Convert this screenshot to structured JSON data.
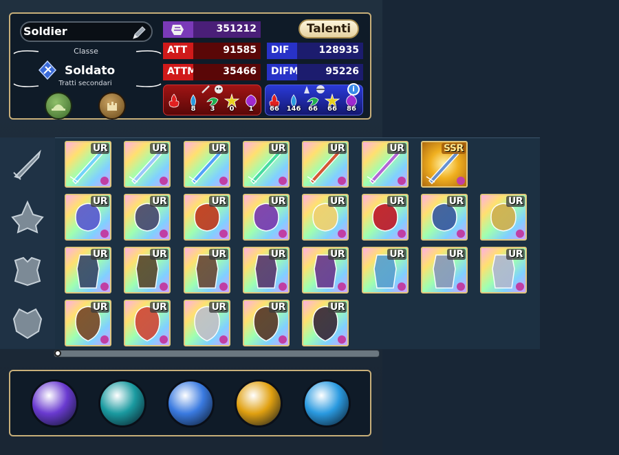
{
  "character": {
    "name": "Soldier",
    "class_heading": "Classe",
    "class_name": "Soldato",
    "traits_label": "Tratti secondari",
    "talent_button": "Talenti"
  },
  "stats": {
    "power": "351212",
    "att_label": "ATT",
    "att": "91585",
    "def_label": "DIF",
    "def": "128935",
    "attm_label": "ATTM",
    "attm": "35466",
    "defm_label": "DIFM",
    "defm": "95226"
  },
  "resist_attack": [
    {
      "icon": "fire-element-icon",
      "value": ""
    },
    {
      "icon": "water-element-icon",
      "value": "8"
    },
    {
      "icon": "wind-element-icon",
      "value": "3"
    },
    {
      "icon": "light-element-icon",
      "value": "0"
    },
    {
      "icon": "dark-element-icon",
      "value": "1"
    }
  ],
  "resist_defense": [
    {
      "icon": "fire-element-icon",
      "value": "66"
    },
    {
      "icon": "water-element-icon",
      "value": "146"
    },
    {
      "icon": "wind-element-icon",
      "value": "66"
    },
    {
      "icon": "light-element-icon",
      "value": "66"
    },
    {
      "icon": "dark-element-icon",
      "value": "86"
    }
  ],
  "equipment_rows": [
    {
      "slot": "weapon-slot-icon",
      "items": [
        {
          "rarity": "UR",
          "kind": "sword",
          "tone": "#6fd0ff"
        },
        {
          "rarity": "UR",
          "kind": "sword",
          "tone": "#9ac2ff"
        },
        {
          "rarity": "UR",
          "kind": "sword",
          "tone": "#4d9cff"
        },
        {
          "rarity": "UR",
          "kind": "sword",
          "tone": "#42d9a0"
        },
        {
          "rarity": "UR",
          "kind": "sword",
          "tone": "#d84a2a"
        },
        {
          "rarity": "UR",
          "kind": "sword",
          "tone": "#b45ad8"
        },
        {
          "rarity": "SSR",
          "kind": "sword",
          "tone": "#5a8ad8"
        }
      ]
    },
    {
      "slot": "accessory-slot-icon",
      "items": [
        {
          "rarity": "UR",
          "kind": "accessory",
          "tone": "#5b5bd0"
        },
        {
          "rarity": "UR",
          "kind": "accessory",
          "tone": "#4a4a70"
        },
        {
          "rarity": "UR",
          "kind": "accessory",
          "tone": "#c03a20"
        },
        {
          "rarity": "UR",
          "kind": "accessory",
          "tone": "#7a3ab0"
        },
        {
          "rarity": "UR",
          "kind": "accessory",
          "tone": "#f0d070"
        },
        {
          "rarity": "UR",
          "kind": "accessory",
          "tone": "#c01a2a"
        },
        {
          "rarity": "UR",
          "kind": "accessory",
          "tone": "#3a5aa0"
        },
        {
          "rarity": "UR",
          "kind": "accessory",
          "tone": "#d0b050"
        }
      ]
    },
    {
      "slot": "armor-slot-icon",
      "items": [
        {
          "rarity": "UR",
          "kind": "armor",
          "tone": "#3a4a6a"
        },
        {
          "rarity": "UR",
          "kind": "armor",
          "tone": "#5a4a30"
        },
        {
          "rarity": "UR",
          "kind": "armor",
          "tone": "#6a4a3a"
        },
        {
          "rarity": "UR",
          "kind": "armor",
          "tone": "#5a3a70"
        },
        {
          "rarity": "UR",
          "kind": "armor",
          "tone": "#6a3a90"
        },
        {
          "rarity": "UR",
          "kind": "armor",
          "tone": "#5aa0d0"
        },
        {
          "rarity": "UR",
          "kind": "armor",
          "tone": "#8a9aba"
        },
        {
          "rarity": "UR",
          "kind": "armor",
          "tone": "#b0b8d0"
        }
      ]
    },
    {
      "slot": "helmet-slot-icon",
      "items": [
        {
          "rarity": "UR",
          "kind": "portrait",
          "tone": "#7a4a2a"
        },
        {
          "rarity": "UR",
          "kind": "portrait",
          "tone": "#d04a3a"
        },
        {
          "rarity": "UR",
          "kind": "portrait",
          "tone": "#c0c0c8"
        },
        {
          "rarity": "UR",
          "kind": "portrait",
          "tone": "#5a3a2a"
        },
        {
          "rarity": "UR",
          "kind": "portrait",
          "tone": "#3a2a3a"
        }
      ]
    }
  ],
  "skills": [
    {
      "icon": "gauntlet-skill-icon",
      "tone": "#6a3ad0"
    },
    {
      "icon": "slash-skill-icon",
      "tone": "#1a9aa0"
    },
    {
      "icon": "heart-skill-icon",
      "tone": "#3a7ae0"
    },
    {
      "icon": "fire-skill-icon",
      "tone": "#e0a010"
    },
    {
      "icon": "wave-skill-icon",
      "tone": "#2a9ae0"
    }
  ],
  "colors": {
    "gold": "#c9b07a",
    "red_stat": "#d01a1a",
    "blue_stat": "#2832c8",
    "power_purple": "#7a3ab8"
  }
}
